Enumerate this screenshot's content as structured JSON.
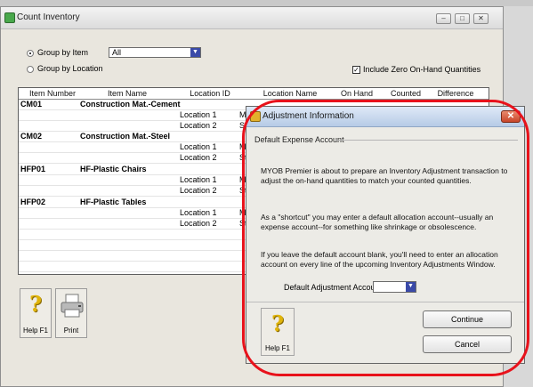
{
  "window": {
    "title": "Count Inventory",
    "controls": [
      "–",
      "□",
      "✕"
    ]
  },
  "filters": {
    "group_by_item": "Group by Item",
    "group_by_location": "Group by Location",
    "item_filter_value": "All",
    "include_zero": "Include Zero On-Hand Quantities",
    "include_zero_checked": true
  },
  "grid": {
    "columns": [
      "Item Number",
      "Item Name",
      "Location ID",
      "Location Name",
      "On Hand",
      "Counted",
      "Difference"
    ],
    "items": [
      {
        "number": "CM01",
        "name": "Construction Mat.-Cement",
        "locations": [
          {
            "id": "Location 1",
            "name": "M"
          },
          {
            "id": "Location 2",
            "name": "St"
          }
        ]
      },
      {
        "number": "CM02",
        "name": "Construction Mat.-Steel",
        "locations": [
          {
            "id": "Location 1",
            "name": "M"
          },
          {
            "id": "Location 2",
            "name": "St"
          }
        ]
      },
      {
        "number": "HFP01",
        "name": "HF-Plastic Chairs",
        "locations": [
          {
            "id": "Location 1",
            "name": "M"
          },
          {
            "id": "Location 2",
            "name": "St"
          }
        ]
      },
      {
        "number": "HFP02",
        "name": "HF-Plastic Tables",
        "locations": [
          {
            "id": "Location 1",
            "name": "M"
          },
          {
            "id": "Location 2",
            "name": "St"
          }
        ]
      }
    ]
  },
  "toolbar": {
    "help_label": "Help F1",
    "print_label": "Print"
  },
  "dialog": {
    "title": "Adjustment Information",
    "section": "Default Expense Account",
    "para1": "MYOB Premier is about to prepare an Inventory Adjustment transaction to adjust the on-hand quantities to match your counted quantities.",
    "para2": "As a \"shortcut\" you may enter a default allocation account--usually an expense account--for something like shrinkage or obsolescence.",
    "para3": "If you leave the default account blank, you'll need to enter an allocation account on every line of the upcoming Inventory Adjustments Window.",
    "default_account_label": "Default Adjustment Account:",
    "default_account_value": "",
    "continue_label": "Continue",
    "cancel_label": "Cancel",
    "help_label": "Help F1"
  },
  "colors": {
    "annotation_ring": "#e8121b",
    "dropdown_button": "#3a4aa8",
    "help_icon": "#e0b40a"
  }
}
